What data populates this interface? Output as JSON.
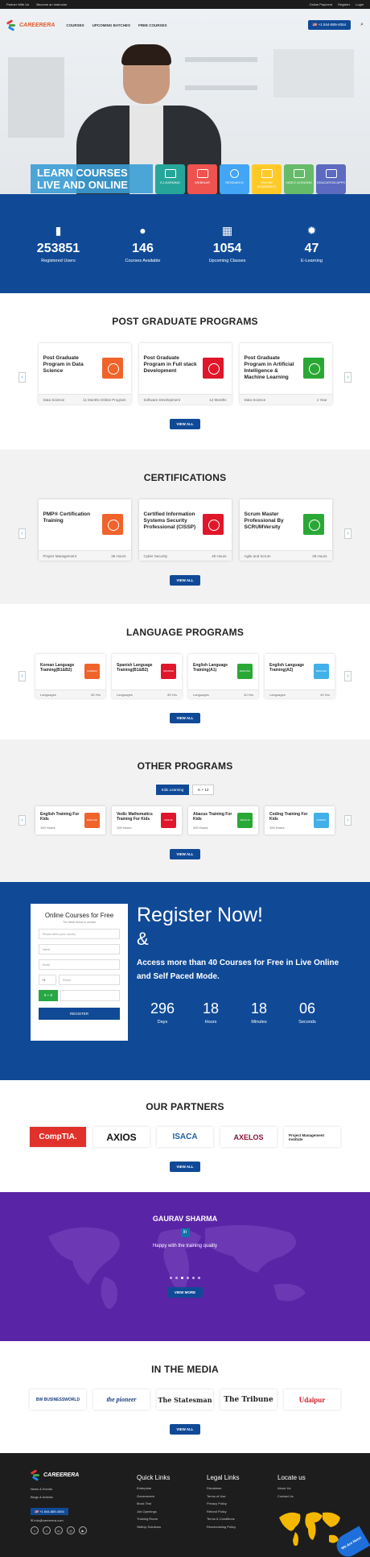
{
  "topbar": {
    "partner": "Partner With Us",
    "instructor": "Become an Instructor",
    "online_payment": "Online Payment",
    "register": "Register",
    "login": "Login"
  },
  "header": {
    "logo": "CAREERERA",
    "menu": [
      "COURSES",
      "UPCOMING BATCHES",
      "FREE COURSES"
    ],
    "phone": "+1 844-889-4054"
  },
  "hero": {
    "headline": [
      "LEARN COURSES",
      "LIVE AND ONLINE"
    ],
    "tiles": [
      {
        "label": "E-LEARNING",
        "color": "#26a69a"
      },
      {
        "label": "WEBINAR",
        "color": "#ef5350"
      },
      {
        "label": "RESEARCH",
        "color": "#42a5f5"
      },
      {
        "label": "ONLINE ACADEMICS",
        "color": "#ffca28"
      },
      {
        "label": "VIDEO LESSONS",
        "color": "#66bb6a"
      },
      {
        "label": "EDUCATION APPS",
        "color": "#5c6bc0"
      }
    ]
  },
  "stats": [
    {
      "icon": "book-icon",
      "glyph": "▮",
      "value": "253851",
      "label": "Registered Users"
    },
    {
      "icon": "user-icon",
      "glyph": "●",
      "value": "146",
      "label": "Courses Available"
    },
    {
      "icon": "calendar-icon",
      "glyph": "▦",
      "value": "1054",
      "label": "Upcoming Classes"
    },
    {
      "icon": "gear-icon",
      "glyph": "✹",
      "value": "47",
      "label": "E-Learning"
    }
  ],
  "pg": {
    "title": "POST GRADUATE PROGRAMS",
    "cards": [
      {
        "title": "Post Graduate Program in Data Science",
        "cat": "Data Science",
        "dur": "11 Months Online Program",
        "color": "#f0632a"
      },
      {
        "title": "Post Graduate Program in Full stack Development",
        "cat": "Software Development",
        "dur": "12 Months",
        "color": "#e0162b"
      },
      {
        "title": "Post Graduate Program in Artificial Intelligence & Machine Learning",
        "cat": "Data Science",
        "dur": "1 Year",
        "color": "#2aa836"
      }
    ],
    "view_all": "VIEW ALL"
  },
  "cert": {
    "title": "CERTIFICATIONS",
    "cards": [
      {
        "title": "PMP® Certification Training",
        "cat": "Project Management",
        "dur": "36 Hours",
        "color": "#f0632a"
      },
      {
        "title": "Certified Information Systems Security Professional (CISSP)",
        "cat": "Cyber Security",
        "dur": "40 Hours",
        "color": "#e0162b"
      },
      {
        "title": "Scrum Master Professional By SCRUMVersity",
        "cat": "Agile and Scrum",
        "dur": "28 Hours",
        "color": "#2aa836"
      }
    ],
    "view_all": "VIEW ALL"
  },
  "lang": {
    "title": "LANGUAGE PROGRAMS",
    "cards": [
      {
        "title": "Korean Language Training(B1&B2)",
        "cat": "Languages",
        "dur": "80 Hrs",
        "badge": "KOREAN",
        "color": "#f0632a"
      },
      {
        "title": "Spanish Language Training(B1&B2)",
        "cat": "Languages",
        "dur": "80 Hrs",
        "badge": "SPANISH",
        "color": "#e0162b"
      },
      {
        "title": "English Language Training(A1)",
        "cat": "Languages",
        "dur": "40 Hrs",
        "badge": "ENGLISH",
        "color": "#2aa836"
      },
      {
        "title": "English Language Training(A2)",
        "cat": "Languages",
        "dur": "40 Hrs",
        "badge": "ENGLISH",
        "color": "#42b0e8"
      }
    ],
    "view_all": "VIEW ALL"
  },
  "other": {
    "title": "OTHER PROGRAMS",
    "toggles": [
      "Kids Learning",
      "K + 12"
    ],
    "cards": [
      {
        "title": "English Training For Kids",
        "sub": "100 Hours",
        "badge": "ENGLISH",
        "color": "#f0632a"
      },
      {
        "title": "Vedic Mathematics Training For Kids",
        "sub": "100 Hours",
        "badge": "MATHS",
        "color": "#e0162b"
      },
      {
        "title": "Abacus Training For Kids",
        "sub": "100 Hours",
        "badge": "ABACUS",
        "color": "#2aa836"
      },
      {
        "title": "Coding Training For Kids",
        "sub": "100 Hours",
        "badge": "CODING",
        "color": "#42b0e8"
      }
    ],
    "view_all": "VIEW ALL"
  },
  "register": {
    "form_title": "Online Courses for Free",
    "form_note": "The fields below to access",
    "country_placeholder": "Please select your country",
    "name_placeholder": "Name",
    "email_placeholder": "Email",
    "country_code": "+1",
    "phone_placeholder": "Phone",
    "captcha": "9 + 8",
    "button": "REGISTER",
    "title": "Register Now!",
    "amp": "&",
    "text": "Access more than 40 Courses for Free in Live Online and Self Paced Mode.",
    "countdown": [
      {
        "value": "296",
        "unit": "Days"
      },
      {
        "value": "18",
        "unit": "Hours"
      },
      {
        "value": "18",
        "unit": "Minutes"
      },
      {
        "value": "06",
        "unit": "Seconds"
      }
    ]
  },
  "partners": {
    "title": "OUR PARTNERS",
    "logos": [
      "CompTIA.",
      "AXIOS",
      "ISACA",
      "AXELOS",
      "Project Management Institute"
    ],
    "view_all": "VIEW ALL"
  },
  "testimonial": {
    "name": "GAURAV SHARMA",
    "quote": "Happy with the training quality",
    "button": "VIEW MORE"
  },
  "media": {
    "title": "IN THE MEDIA",
    "logos": [
      "BW BUSINESSWORLD",
      "the pioneer",
      "The Statesman",
      "The Tribune",
      "Udaipur"
    ],
    "view_all": "VIEW ALL"
  },
  "footer": {
    "logo": "CAREERERA",
    "left_links": [
      "News & Events",
      "Blogs & Articles"
    ],
    "phone": "+1 844-889-4054",
    "email": "info@careerera.com",
    "quick_title": "Quick Links",
    "quick": [
      "Enterprise",
      "Government",
      "Mock Test",
      "Job Openings",
      "Training Room",
      "SkillUp Solutions"
    ],
    "legal_title": "Legal Links",
    "legal": [
      "Disclaimer",
      "Terms of Use",
      "Privacy Policy",
      "Refund Policy",
      "Terms & Conditions",
      "Rescheduling Policy"
    ],
    "locate_title": "Locate us",
    "locate": [
      "About Us",
      "Contact Us"
    ],
    "hiring": "We Are Here!"
  }
}
